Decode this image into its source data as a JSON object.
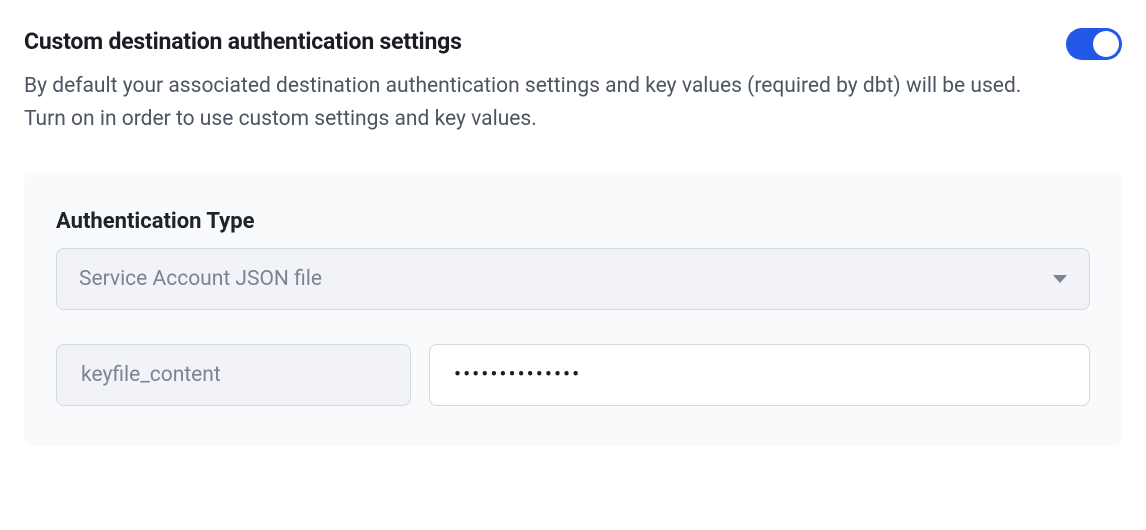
{
  "section": {
    "title": "Custom destination authentication settings",
    "description": "By default your associated destination authentication settings and key values (required by dbt) will be used. Turn on in order to use custom settings and key values.",
    "toggle_on": true
  },
  "auth": {
    "type_label": "Authentication Type",
    "type_selected": "Service Account JSON file",
    "key_label": "keyfile_content",
    "key_value": "••••••••••••••"
  }
}
